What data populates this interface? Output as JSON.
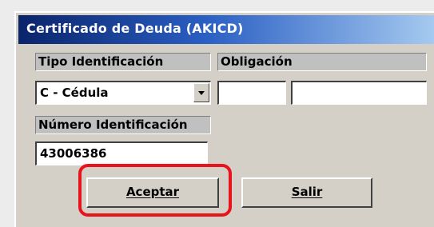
{
  "window": {
    "title": "Certificado de Deuda (AKICD)"
  },
  "form": {
    "tipo_label": "Tipo Identificación",
    "tipo_value": "C - Cédula",
    "obligacion_label": "Obligación",
    "obligacion_value_1": "",
    "obligacion_value_2": "",
    "numero_label": "Número Identificación",
    "numero_value": "43006386"
  },
  "buttons": {
    "aceptar": "Aceptar",
    "salir": "Salir"
  },
  "colors": {
    "titlebar_start": "#0a246a",
    "titlebar_end": "#a6caf0",
    "highlight": "#e8141b",
    "face": "#d4d0c8"
  }
}
